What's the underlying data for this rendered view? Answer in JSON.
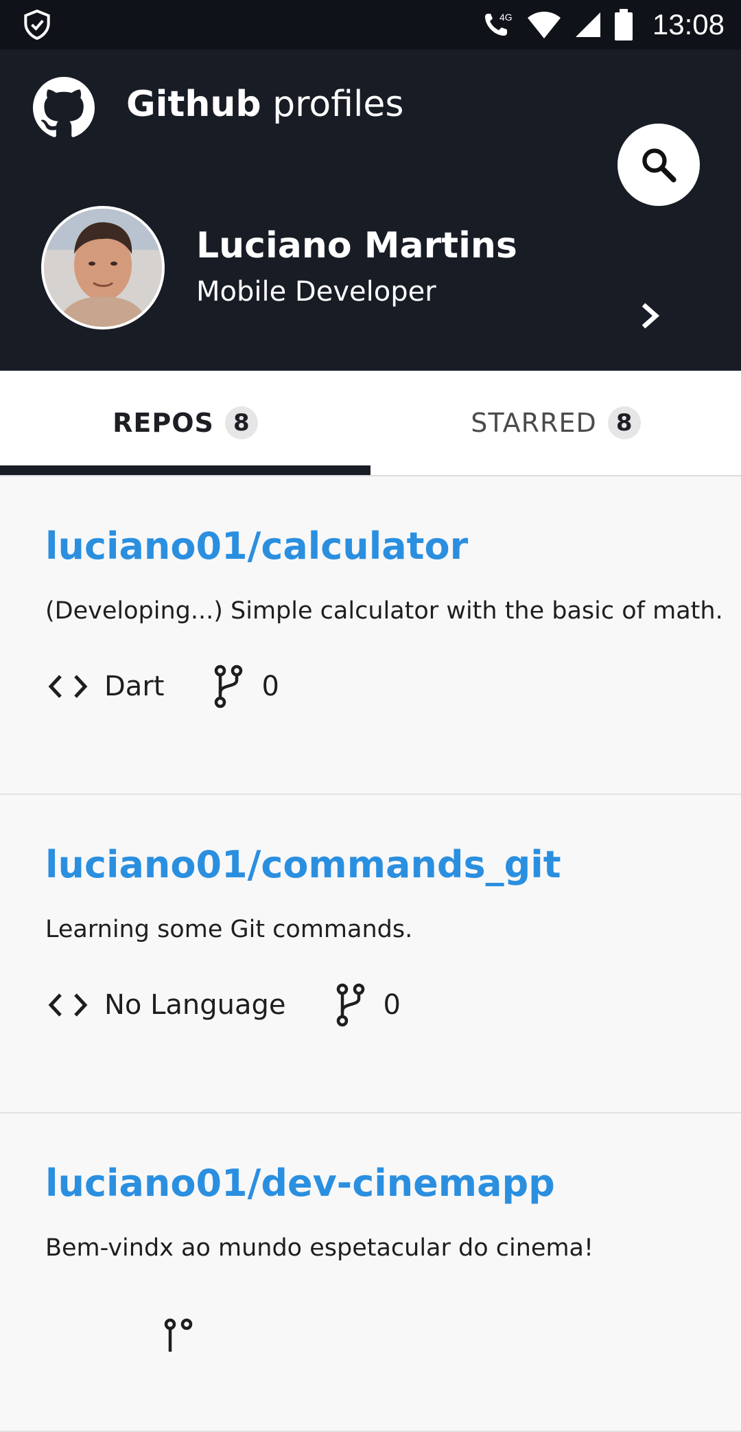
{
  "status_bar": {
    "time": "13:08",
    "network": "4G"
  },
  "header": {
    "title_bold": "Github",
    "title_light": "profiles"
  },
  "profile": {
    "name": "Luciano Martins",
    "role": "Mobile Developer"
  },
  "tabs": [
    {
      "label": "REPOS",
      "count": "8",
      "active": true
    },
    {
      "label": "STARRED",
      "count": "8",
      "active": false
    }
  ],
  "repos": [
    {
      "name": "luciano01/calculator",
      "description": "(Developing...) Simple calculator with the basic of math.",
      "language": "Dart",
      "forks": "0"
    },
    {
      "name": "luciano01/commands_git",
      "description": "Learning some Git commands.",
      "language": "No Language",
      "forks": "0"
    },
    {
      "name": "luciano01/dev-cinemapp",
      "description": "Bem-vindx ao mundo espetacular do cinema!",
      "language": "",
      "forks": ""
    }
  ],
  "colors": {
    "header_bg": "#181c25",
    "accent_link": "#2b8fe0"
  }
}
